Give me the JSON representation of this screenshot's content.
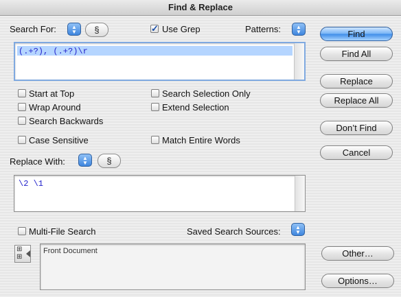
{
  "window": {
    "title": "Find & Replace"
  },
  "search": {
    "label": "Search For:",
    "value": "(.+?), (.+?)\\r",
    "use_grep_label": "Use Grep",
    "use_grep_checked": true,
    "patterns_label": "Patterns:",
    "section_symbol": "§"
  },
  "options": {
    "start_at_top": "Start at Top",
    "wrap_around": "Wrap Around",
    "search_backwards": "Search Backwards",
    "case_sensitive": "Case Sensitive",
    "search_selection_only": "Search Selection Only",
    "extend_selection": "Extend Selection",
    "match_entire_words": "Match Entire Words"
  },
  "replace": {
    "label": "Replace With:",
    "value": "\\2 \\1",
    "section_symbol": "§"
  },
  "multifile": {
    "label": "Multi-File Search",
    "saved_sources_label": "Saved Search Sources:",
    "sources_value": "Front Document"
  },
  "buttons": {
    "find": "Find",
    "find_all": "Find All",
    "replace": "Replace",
    "replace_all": "Replace All",
    "dont_find": "Don’t Find",
    "cancel": "Cancel",
    "other": "Other…",
    "options": "Options…"
  },
  "colors": {
    "accent": "#3d8ce8",
    "selection": "#b5d5ff",
    "grep_text": "#2222cc"
  }
}
